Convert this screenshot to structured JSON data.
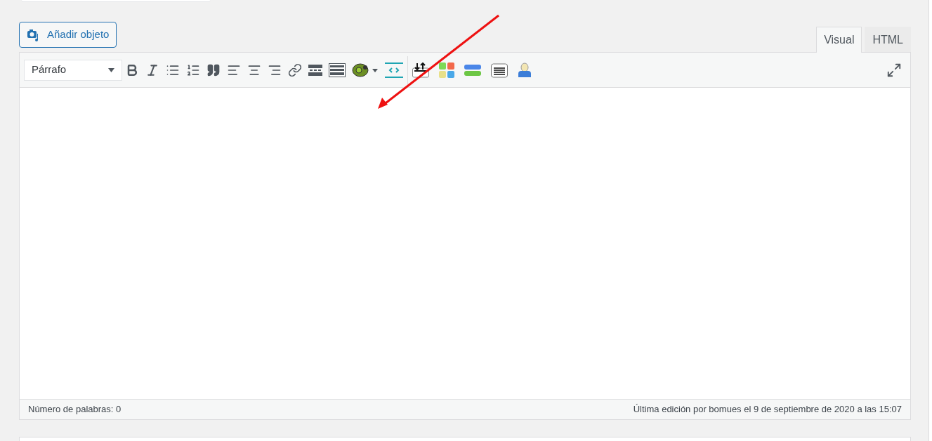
{
  "add_media_button": {
    "label": "Añadir objeto"
  },
  "tabs": [
    {
      "label": "Visual",
      "selected": true
    },
    {
      "label": "HTML",
      "selected": false
    }
  ],
  "toolbar": {
    "format_select": {
      "value": "Párrafo"
    }
  },
  "status_bar": {
    "word_count": "Número de palabras: 0",
    "last_edit": "Última edición por bomues el 9 de septiembre de 2020 a las 15:07"
  }
}
